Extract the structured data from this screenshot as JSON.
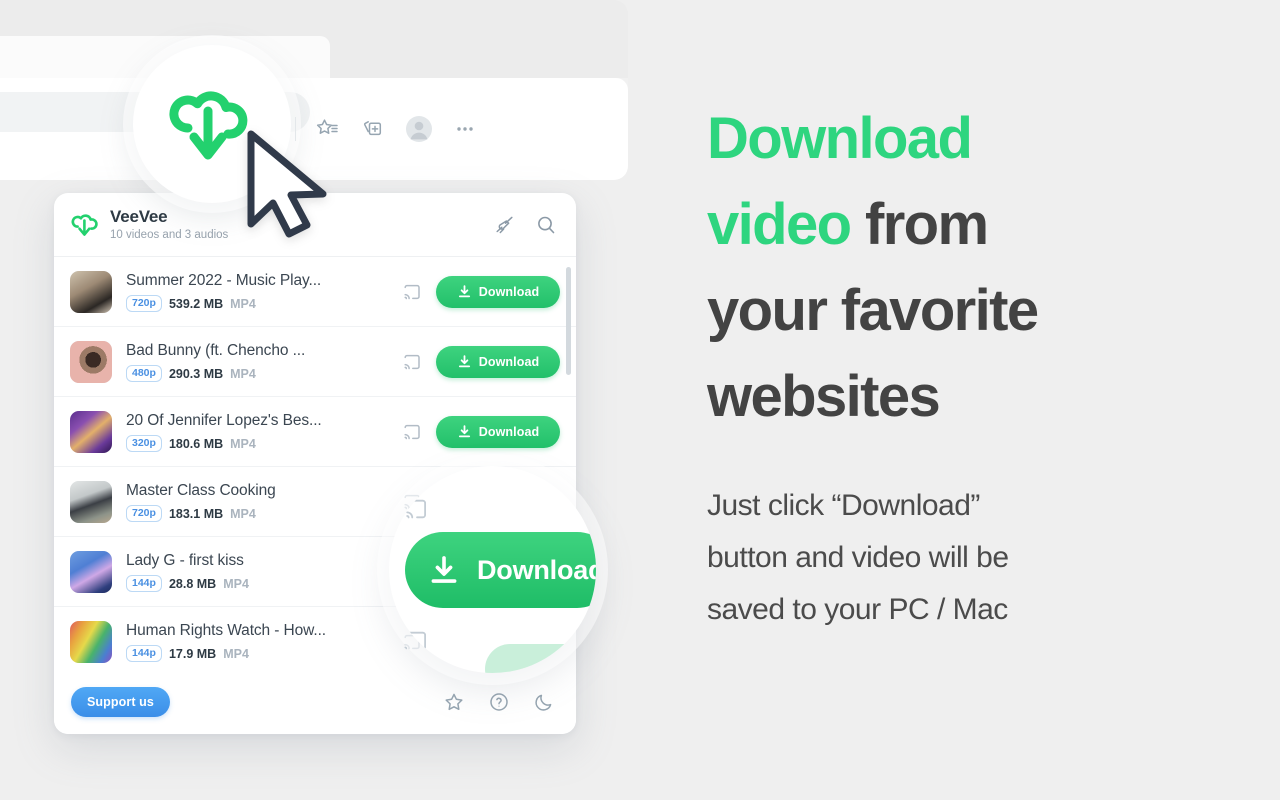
{
  "browser": {
    "toolbar_icons": [
      {
        "name": "extensions-puzzle-icon",
        "label": "Extensions"
      },
      {
        "name": "divider",
        "label": "|"
      },
      {
        "name": "collections-star-icon",
        "label": "Collections"
      },
      {
        "name": "add-to-collection-icon",
        "label": "Add to collection"
      },
      {
        "name": "profile-avatar-icon",
        "label": "Profile"
      },
      {
        "name": "more-options-icon",
        "label": "More"
      }
    ],
    "highlighted_extension": "veevee-extension-icon",
    "cursor": "mouse-pointer"
  },
  "app": {
    "logo_icon": "veevee-cloud-download-icon",
    "title": "VeeVee",
    "subtitle": "10 videos and 3 audios",
    "header_actions": [
      {
        "name": "clean-broom-icon",
        "label": "Clear list"
      },
      {
        "name": "search-icon",
        "label": "Search"
      }
    ],
    "videos": [
      {
        "title": "Summer 2022 - Music Play...",
        "quality": "720p",
        "size": "539.2 MB",
        "format": "MP4",
        "cast_label": "Cast",
        "download_label": "Download",
        "thumb_colors": [
          "#b9b1a4",
          "#2e2a27",
          "#d6c7b4"
        ]
      },
      {
        "title": "Bad Bunny (ft. Chencho ...",
        "quality": "480p",
        "size": "290.3 MB",
        "format": "MP4",
        "cast_label": "Cast",
        "download_label": "Download",
        "thumb_colors": [
          "#e8b3ab",
          "#3a2a24",
          "#c98c7f"
        ]
      },
      {
        "title": "20 Of Jennifer Lopez's Bes...",
        "quality": "320p",
        "size": "180.6 MB",
        "format": "MP4",
        "cast_label": "Cast",
        "download_label": "Download",
        "thumb_colors": [
          "#6b3fa0",
          "#d9a05b",
          "#3b1f5c"
        ]
      },
      {
        "title": "Master Class Cooking",
        "quality": "720p",
        "size": "183.1 MB",
        "format": "MP4",
        "cast_label": "Cast",
        "download_label": "Download",
        "thumb_colors": [
          "#cfd3d4",
          "#3b3f45",
          "#9aa09c"
        ]
      },
      {
        "title": "Lady G - first kiss",
        "quality": "144p",
        "size": "28.8 MB",
        "format": "MP4",
        "cast_label": "Cast",
        "download_label": "Download",
        "thumb_colors": [
          "#4f7fd4",
          "#c8a3e0",
          "#2a3f7a"
        ]
      },
      {
        "title": "Human Rights Watch - How...",
        "quality": "144p",
        "size": "17.9 MB",
        "format": "MP4",
        "cast_label": "Cast",
        "download_label": "Download",
        "thumb_colors": [
          "#e05b5b",
          "#49b36b",
          "#d9c244"
        ]
      }
    ],
    "footer": {
      "support_label": "Support us",
      "icons": [
        {
          "name": "star-icon",
          "label": "Rate us"
        },
        {
          "name": "help-question-icon",
          "label": "Help"
        },
        {
          "name": "dark-mode-moon-icon",
          "label": "Dark mode"
        }
      ]
    }
  },
  "magnified_button": {
    "label": "Download",
    "icon": "download-arrow-icon"
  },
  "marketing": {
    "headline_parts": [
      {
        "text": "Download",
        "accent": true
      },
      {
        "text": "video",
        "accent": true
      },
      {
        "text": "from",
        "accent": false
      },
      {
        "text": "your favorite",
        "accent": false
      },
      {
        "text": "websites",
        "accent": false
      }
    ],
    "headline_line1": "Download",
    "headline_line2_green": "video ",
    "headline_line2_dark": "from",
    "headline_line3": "your favorite",
    "headline_line4": "websites",
    "subcopy_line1": "Just click “Download”",
    "subcopy_line2": "button and video will be",
    "subcopy_line3": "saved to your PC / Mac"
  },
  "colors": {
    "accent_green": "#2ed57f",
    "button_green": "#22c06a",
    "support_blue": "#3b8ee8",
    "badge_blue": "#4a90e2",
    "text_dark": "#434343",
    "page_bg": "#efefef"
  }
}
